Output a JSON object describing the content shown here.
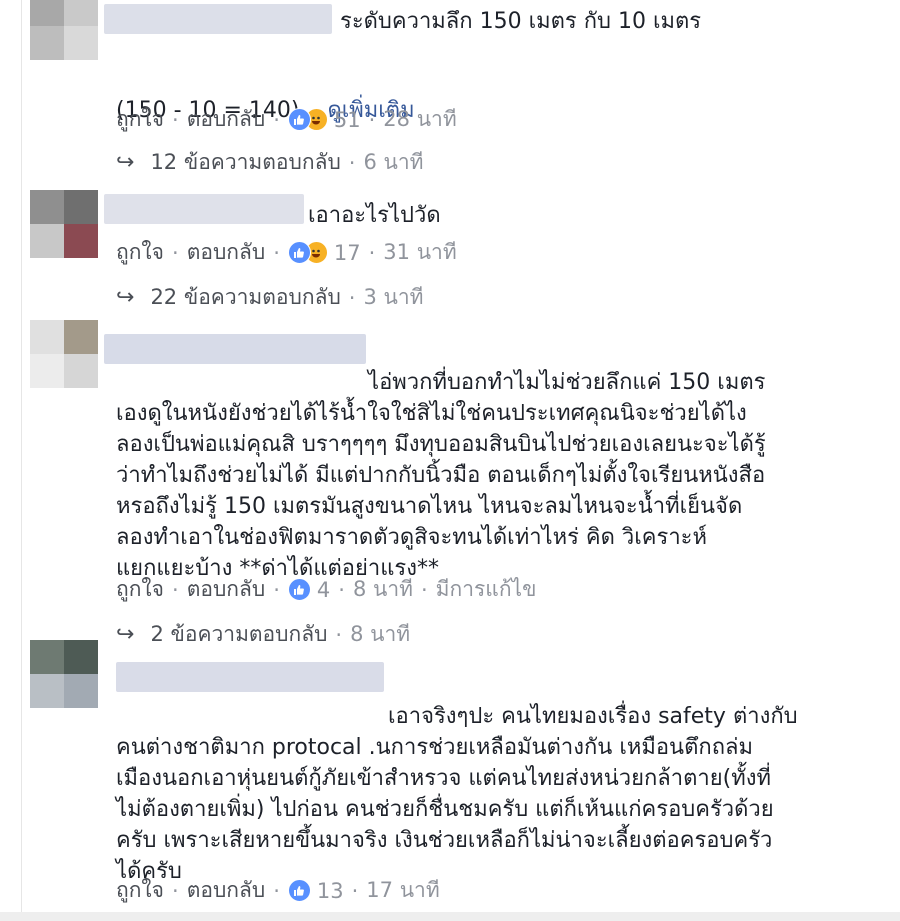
{
  "labels": {
    "like": "ถูกใจ",
    "reply": "ตอบกลับ",
    "sep": "·"
  },
  "comments": [
    {
      "text": "ระดับความลึก 150 เมตร กับ 10 เมตร",
      "text2": "(150 - 10 = 140)... ",
      "see_more": "ดูเพิ่มเติม",
      "reaction_count": "51",
      "time": "28 นาที",
      "replies_label": "12 ข้อความตอบกลับ",
      "replies_time": "6 นาที",
      "reaction_icons": [
        "like-icon",
        "haha-icon"
      ]
    },
    {
      "text": "เอาอะไรไปวัด",
      "reaction_count": "17",
      "time": "31 นาที",
      "replies_label": "22 ข้อความตอบกลับ",
      "replies_time": "3 นาที",
      "reaction_icons": [
        "like-icon",
        "haha-icon"
      ]
    },
    {
      "text": "ไอ่พวกที่บอกทำไมไม่ช่วยลึกแค่ 150 เมตร\nเองดูในหนังยังช่วยได้ไร้น้ำใจใช่สิไม่ใช่คนประเทศคุณนิจะช่วยได้ไง\nลองเป็นพ่อแม่คุณสิ บราๆๆๆๆ มึงทุบออมสินบินไปช่วยเองเลยนะจะได้รู้\nว่าทำไมถึงช่วยไม่ได้ มีแต่ปากกับนิ้วมือ ตอนเด็กๆไม่ตั้งใจเรียนหนังสือ\nหรอถึงไม่รู้ 150 เมตรมันสูงขนาดไหน ไหนจะลมไหนจะน้ำที่เย็นจัด\nลองทำเอาในช่องฟิตมาราดตัวดูสิจะทนได้เท่าไหร่ คิด วิเคราะห์\nแยกแยะบ้าง **ด่าได้แต่อย่าแรง**",
      "reaction_count": "4",
      "time": "8 นาที",
      "edited": "มีการแก้ไข",
      "replies_label": "2 ข้อความตอบกลับ",
      "replies_time": "8 นาที",
      "reaction_icons": [
        "like-icon"
      ]
    },
    {
      "text": "เอาจริงๆปะ คนไทยมองเรื่อง safety ต่างกับ\nคนต่างชาติมาก protocal .นการช่วยเหลือมันต่างกัน เหมือนตึกถล่ม\nเมืองนอกเอาหุ่นยนต์กู้ภัยเข้าสำหรวจ แต่คนไทยส่งหน่วยกล้าตาย(ทั้งที่\nไม่ต้องตายเพิ่ม) ไปก่อน คนช่วยก็ชื่นชมครับ แต่ก็เห้นแก่ครอบครัวด้วย\nครับ เพราะเสียหายขึ้นมาจริง เงินช่วยเหลือก็ไม่น่าจะเลี้ยงต่อครอบครัว\nได้ครับ",
      "reaction_count": "13",
      "time": "17 นาที",
      "reaction_icons": [
        "like-icon"
      ]
    }
  ],
  "colors": {
    "link": "#4b4f56",
    "meta": "#90949c",
    "like": "#5890ff",
    "haha": "#f7b125"
  }
}
